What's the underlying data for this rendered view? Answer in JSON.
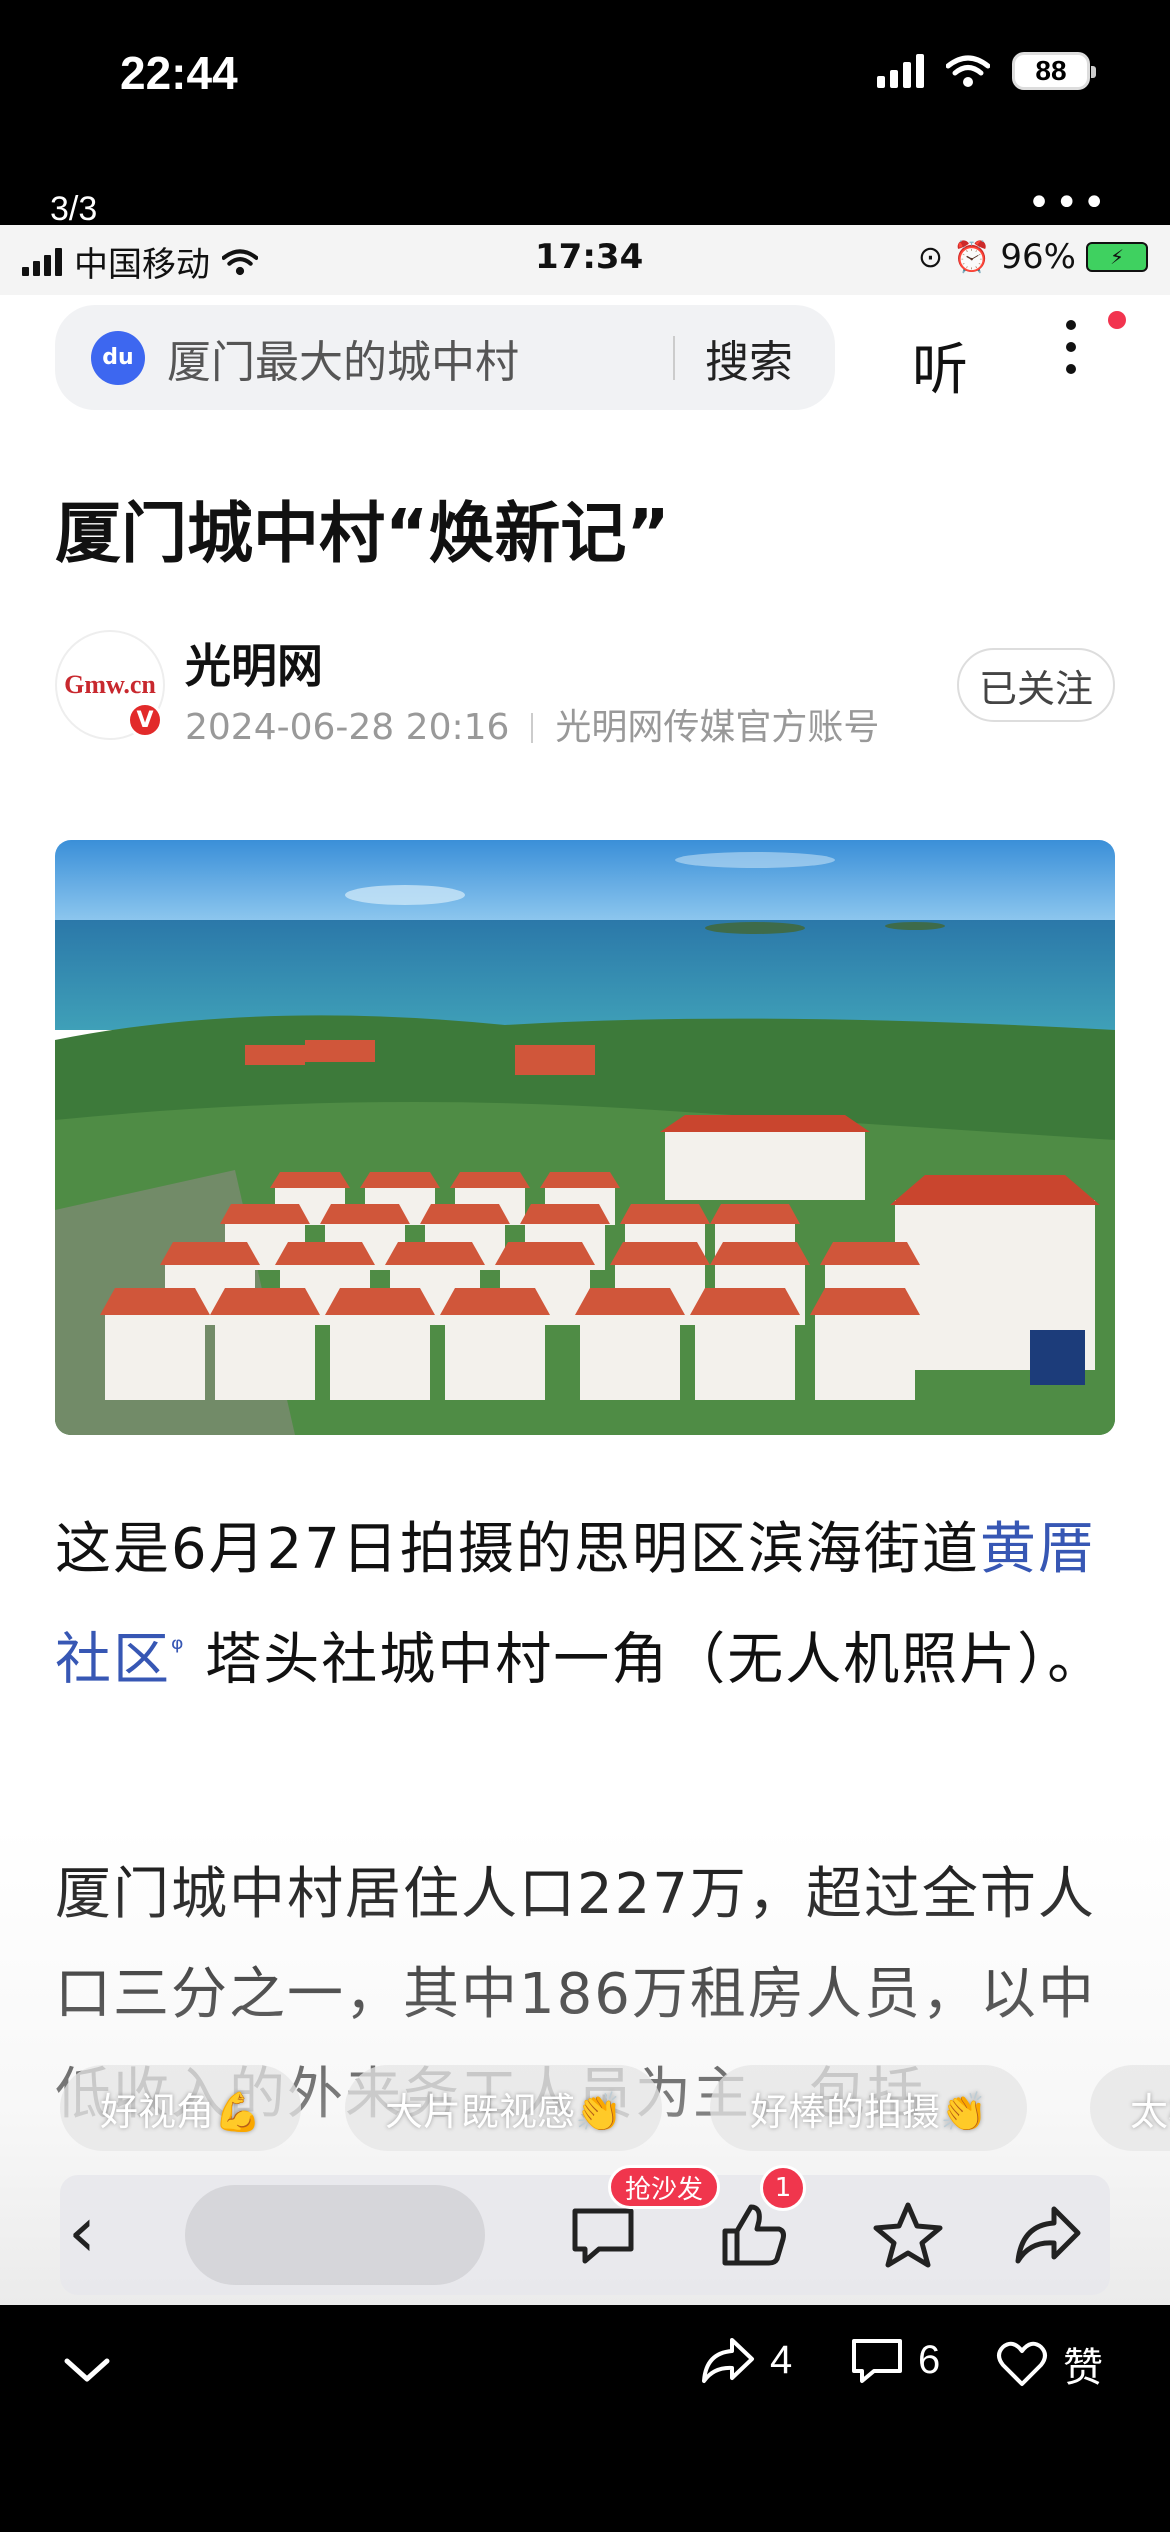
{
  "outer_status": {
    "time": "22:44",
    "battery": "88"
  },
  "viewer": {
    "page_counter": "3/3",
    "more": "•••"
  },
  "inner_status": {
    "carrier": "中国移动",
    "time": "17:34",
    "battery": "96%"
  },
  "search": {
    "query": "厦门最大的城中村",
    "button": "搜索",
    "du_label": "du"
  },
  "header": {
    "listen": "听"
  },
  "article": {
    "title": "厦门城中村“焕新记”",
    "author": "光明网",
    "avatar_text": "Gmw.cn",
    "verified": "V",
    "date": "2024-06-28 20:16",
    "source": "光明网传媒官方账号",
    "follow": "已关注",
    "p1_before": "这是6月27日拍摄的思明区滨海街道",
    "p1_link": "黄厝社区",
    "p1_after": " 塔头社城中村一角（无人机照片）。",
    "p2": "厦门城中村居住人口227万，超过全市人口三分之一，其中186万租房人员，以中低收入的外来务工人员为主，包括"
  },
  "comment_chips": [
    "好视角💪",
    "大片既视感👏",
    "好棒的拍摄👏",
    "太棒"
  ],
  "toolbar": {
    "sofa": "抢沙发",
    "like_count": "1"
  },
  "bottom": {
    "share_count": "4",
    "comment_count": "6",
    "like_label": "赞"
  }
}
